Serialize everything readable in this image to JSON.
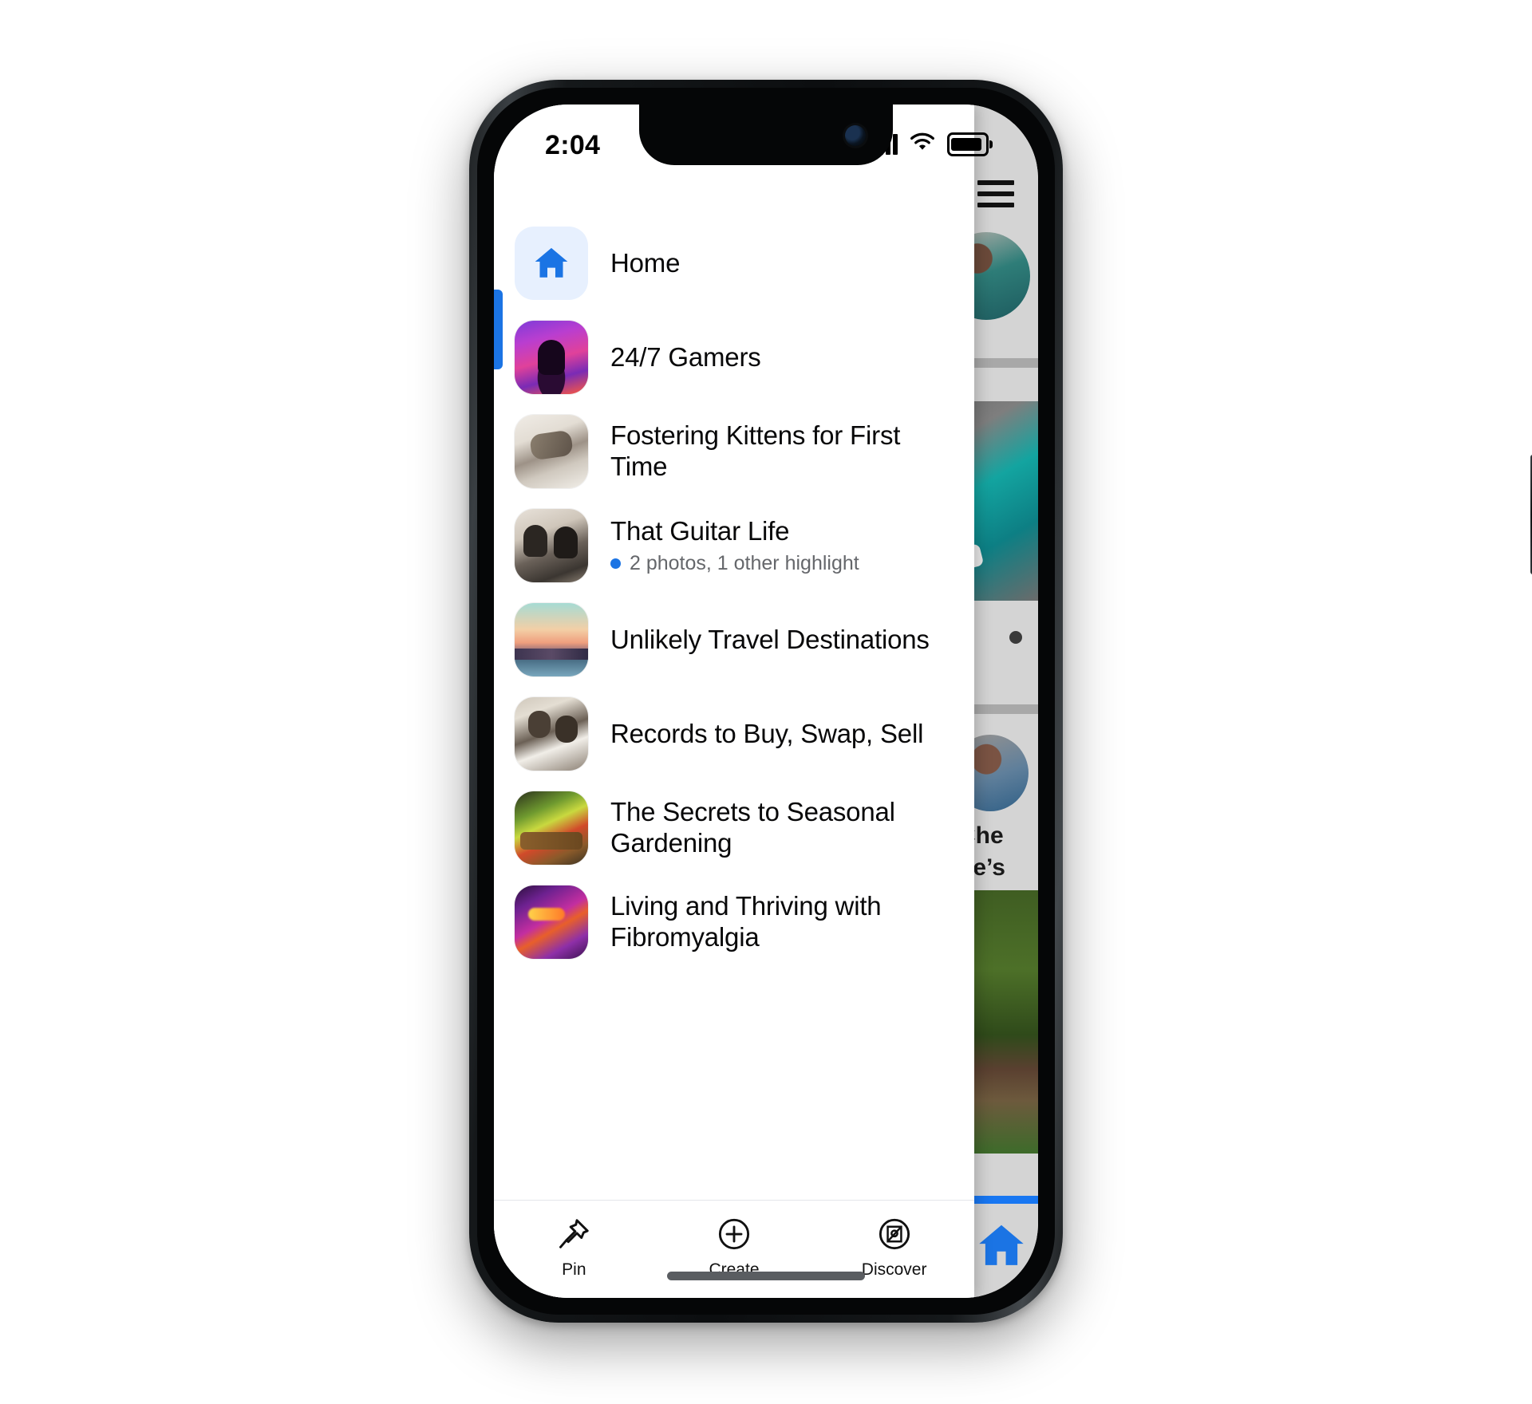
{
  "status_bar": {
    "time": "2:04",
    "signal_icon": "cellular-signal-icon",
    "wifi_icon": "wifi-icon",
    "battery_icon": "battery-full-icon"
  },
  "drawer": {
    "selected_index": 0,
    "accent_color": "#1b74e4",
    "items": [
      {
        "label": "Home",
        "icon": "home-icon",
        "thumb": "home",
        "subtitle": null
      },
      {
        "label": "24/7 Gamers",
        "icon": "group-thumbnail",
        "thumb": "gamers",
        "subtitle": null
      },
      {
        "label": "Fostering Kittens for First Time",
        "icon": "group-thumbnail",
        "thumb": "kitten",
        "subtitle": null
      },
      {
        "label": "That Guitar Life",
        "icon": "group-thumbnail",
        "thumb": "guitar",
        "subtitle": "2 photos, 1 other highlight"
      },
      {
        "label": "Unlikely Travel Destinations",
        "icon": "group-thumbnail",
        "thumb": "travel",
        "subtitle": null
      },
      {
        "label": "Records to Buy, Swap, Sell",
        "icon": "group-thumbnail",
        "thumb": "records",
        "subtitle": null
      },
      {
        "label": "The Secrets to Seasonal Gardening",
        "icon": "group-thumbnail",
        "thumb": "garden",
        "subtitle": null
      },
      {
        "label": "Living and Thriving with Fibromyalgia",
        "icon": "group-thumbnail",
        "thumb": "fibro",
        "subtitle": null
      }
    ]
  },
  "bottom_nav": {
    "items": [
      {
        "label": "Pin",
        "icon": "pin-icon"
      },
      {
        "label": "Create",
        "icon": "plus-circle-icon"
      },
      {
        "label": "Discover",
        "icon": "discover-compass-icon"
      }
    ]
  },
  "background_feed": {
    "menu_icon": "hamburger-menu-icon",
    "post_text_line1": "Che",
    "post_text_line2": "he’s"
  }
}
